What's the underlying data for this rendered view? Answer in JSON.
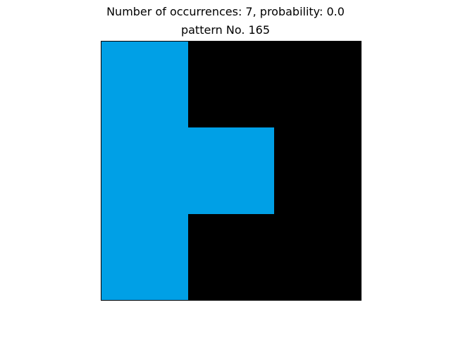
{
  "title": {
    "line1": "Number of occurrences: 7, probability: 0.0",
    "line2": "pattern No. 165"
  },
  "pattern": {
    "rows": 3,
    "cols": 3,
    "colors": {
      "fill": "#00a0e6",
      "background": "#000000"
    },
    "cells": [
      [
        1,
        0,
        0
      ],
      [
        1,
        1,
        0
      ],
      [
        1,
        0,
        0
      ]
    ]
  }
}
